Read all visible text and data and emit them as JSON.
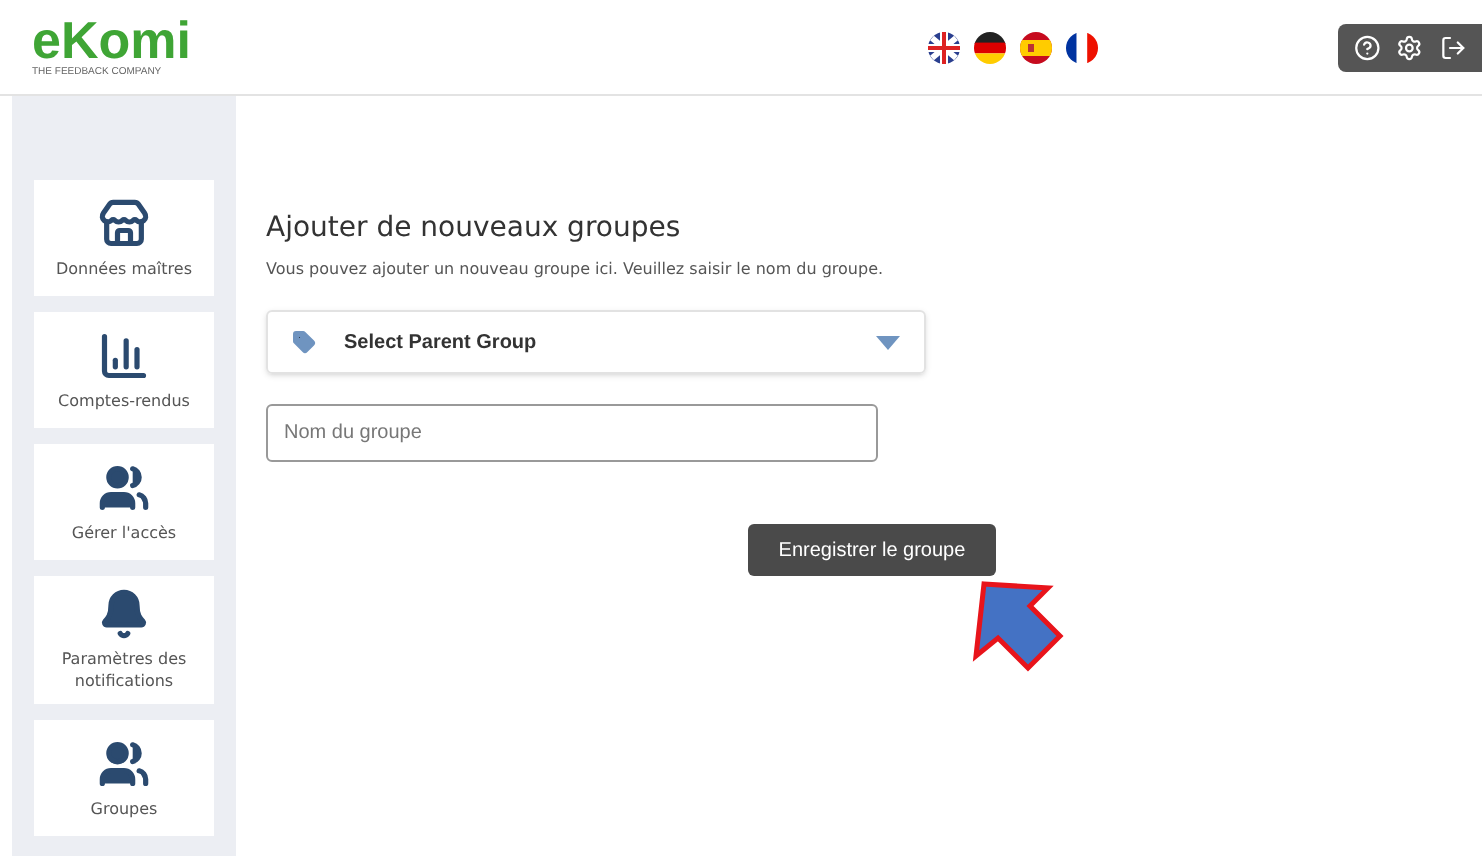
{
  "header": {
    "logo": "eKomi",
    "tagline": "THE FEEDBACK COMPANY",
    "flags": [
      {
        "kind": "uk"
      },
      {
        "kind": "de"
      },
      {
        "kind": "es"
      },
      {
        "kind": "fr"
      }
    ]
  },
  "sidebar": {
    "items": [
      {
        "label": "Données maîtres",
        "kind": "store"
      },
      {
        "label": "Comptes-rendus",
        "kind": "report"
      },
      {
        "label": "Gérer l'accès",
        "kind": "people"
      },
      {
        "label": "Paramètres des notifications",
        "kind": "bell"
      },
      {
        "label": "Groupes",
        "kind": "people"
      }
    ]
  },
  "main": {
    "title": "Ajouter de nouveaux groupes",
    "description": "Vous pouvez ajouter un nouveau groupe ici. Veuillez saisir le nom du groupe.",
    "parent_select": {
      "value": "Select Parent Group"
    },
    "name_field": {
      "placeholder": "Nom du groupe"
    },
    "save_button": "Enregistrer le groupe"
  }
}
